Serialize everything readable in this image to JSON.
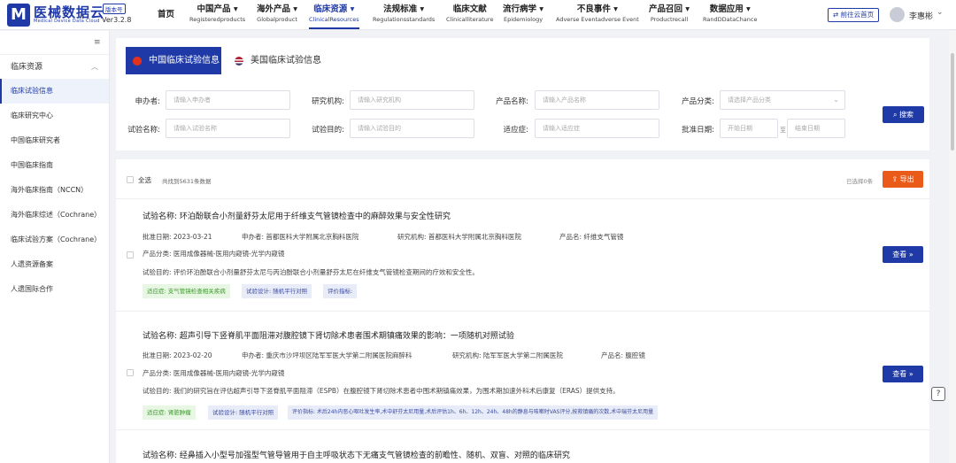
{
  "header": {
    "brand": "医械数据云",
    "brand_sub": "Medical Device Data Cloud",
    "version_badge": "版本号",
    "version": "Ver3.2.8",
    "nav": [
      {
        "zh": "首页",
        "en": ""
      },
      {
        "zh": "中国产品 ▾",
        "en": "Registeredproducts"
      },
      {
        "zh": "海外产品 ▾",
        "en": "Globalproduct"
      },
      {
        "zh": "临床资源 ▾",
        "en": "ClinicalResources"
      },
      {
        "zh": "法规标准 ▾",
        "en": "Regulationsstandards"
      },
      {
        "zh": "临床文献",
        "en": "Clinicalliterature"
      },
      {
        "zh": "流行病学 ▾",
        "en": "Epidemiology"
      },
      {
        "zh": "不良事件 ▾",
        "en": "Adverse Eventadverse Event"
      },
      {
        "zh": "产品召回 ▾",
        "en": "Productrecall"
      },
      {
        "zh": "数据应用 ▾",
        "en": "RandDDataChance"
      }
    ],
    "goto_cloud": "⇄ 前往云首页",
    "user_name": "李惠彬"
  },
  "sidebar": {
    "group": "临床资源",
    "items": [
      "临床试验信息",
      "临床研究中心",
      "中国临床研究者",
      "中国临床指南",
      "海外临床指南（NCCN）",
      "海外临床综述（Cochrane）",
      "临床试验方案（Cochrane）",
      "人遗资源备案",
      "人遗国际合作"
    ]
  },
  "tabs": [
    "中国临床试验信息",
    "美国临床试验信息"
  ],
  "form": {
    "sponsor_label": "申办者:",
    "sponsor_ph": "请输入申办者",
    "institution_label": "研究机构:",
    "institution_ph": "请输入研究机构",
    "product_label": "产品名称:",
    "product_ph": "请输入产品名称",
    "category_label": "产品分类:",
    "category_ph": "请选择产品分类",
    "trial_name_label": "试验名称:",
    "trial_name_ph": "请输入试验名称",
    "purpose_label": "试验目的:",
    "purpose_ph": "请输入试验目的",
    "indication_label": "适应症:",
    "indication_ph": "请输入适应症",
    "approval_label": "批准日期:",
    "start_ph": "开始日期",
    "date_sep": "至",
    "end_ph": "结束日期",
    "search_btn": "⌕ 搜索"
  },
  "results": {
    "select_all": "全选",
    "found": "共找到5631条数据",
    "selected": "已选择0条",
    "export_btn": "⇪ 导出",
    "view_btn": "查看 »",
    "cards": [
      {
        "title": "试验名称:   环泊酚联合小剂量舒芬太尼用于纤维支气管镜检查中的麻醉效果与安全性研究",
        "date": "批准日期:   2023-03-21",
        "sponsor": "申办者:   首都医科大学附属北京胸科医院",
        "institution": "研究机构:   首都医科大学附属北京胸科医院",
        "product": "产品名:   纤维支气管镜",
        "category": "产品分类:  医用成像器械-医用内窥镜-光学内窥镜",
        "purpose": "试验目的:   评价环泊酚联合小剂量舒芬太尼与丙泊酚联合小剂量舒芬太尼在纤维支气管镜检查期间的疗效和安全性。",
        "tag1": "适应症:   支气管镜检查相关疾病",
        "tag2": "试验设计:   随机平行对照",
        "tag3": "评价指标:"
      },
      {
        "title": "试验名称:   超声引导下竖脊肌平面阻滞对腹腔镜下肾切除术患者围术期镇痛效果的影响：一项随机对照试验",
        "date": "批准日期:   2023-02-20",
        "sponsor": "申办者:   重庆市沙坪坝区陆军军医大学第二附属医院麻醉科",
        "institution": "研究机构:   陆军军医大学第二附属医院",
        "product": "产品名:   腹腔镜",
        "category": "产品分类:  医用成像器械-医用内窥镜-光学内窥镜",
        "purpose": "试验目的:   我们的研究旨在评估超声引导下竖脊肌平面阻滞（ESPB）在腹腔镜下肾切除术患者中围术期镇痛效果，为围术期加速外科术后康复（ERAS）提供支持。",
        "tag1": "适应症:   肾脏肿瘤",
        "tag2": "试验设计:   随机平行对照",
        "tag3": "评价指标: 术后24h内恶心呕吐发生率,术中舒芬太尼用量,术后评估1h、6h、12h、24h、48h的静息与咳嗽时VAS评分,按救镇痛的次数,术中瑞芬太尼用量"
      },
      {
        "title": "试验名称:   经鼻插入小型号加强型气管导管用于自主呼吸状态下无痛支气管镜检查的前瞻性、随机、双盲、对照的临床研究"
      }
    ]
  }
}
